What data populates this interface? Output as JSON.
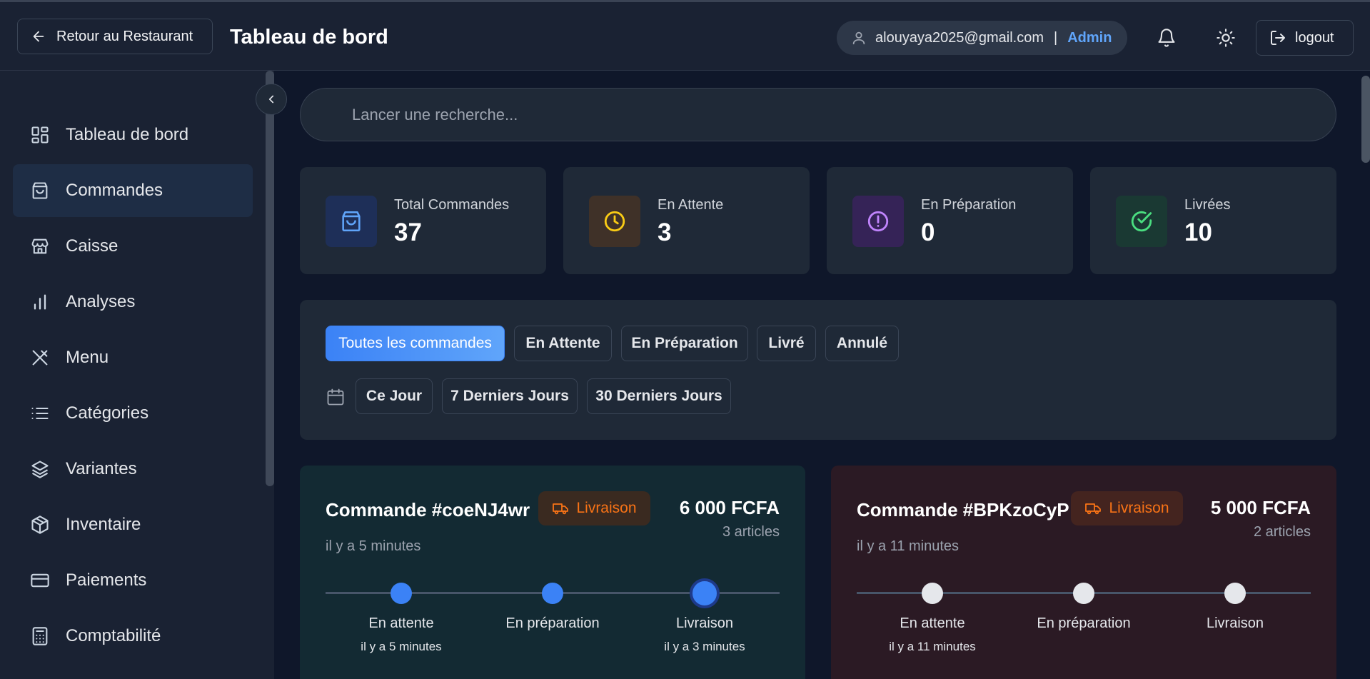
{
  "header": {
    "back_label": "Retour au Restaurant",
    "title": "Tableau de bord",
    "user_email": "alouyaya2025@gmail.com",
    "separator": "|",
    "user_role": "Admin",
    "logout_label": "logout"
  },
  "sidebar": {
    "items": [
      {
        "label": "Tableau de bord",
        "icon": "dashboard-icon"
      },
      {
        "label": "Commandes",
        "icon": "shopping-bag-icon",
        "active": true
      },
      {
        "label": "Caisse",
        "icon": "store-icon"
      },
      {
        "label": "Analyses",
        "icon": "bar-chart-icon"
      },
      {
        "label": "Menu",
        "icon": "utensils-icon"
      },
      {
        "label": "Catégories",
        "icon": "list-icon"
      },
      {
        "label": "Variantes",
        "icon": "layers-icon"
      },
      {
        "label": "Inventaire",
        "icon": "package-icon"
      },
      {
        "label": "Paiements",
        "icon": "credit-card-icon"
      },
      {
        "label": "Comptabilité",
        "icon": "calculator-icon"
      }
    ]
  },
  "search": {
    "placeholder": "Lancer une recherche..."
  },
  "stats": [
    {
      "label": "Total Commandes",
      "value": "37",
      "color": "#60a5fa"
    },
    {
      "label": "En Attente",
      "value": "3",
      "color": "#facc15"
    },
    {
      "label": "En Préparation",
      "value": "0",
      "color": "#c084fc"
    },
    {
      "label": "Livrées",
      "value": "10",
      "color": "#4ade80"
    }
  ],
  "filters": {
    "status": [
      "Toutes les commandes",
      "En Attente",
      "En Préparation",
      "Livré",
      "Annulé"
    ],
    "active_status": "Toutes les commandes",
    "periods": [
      "Ce Jour",
      "7 Derniers Jours",
      "30 Derniers Jours"
    ]
  },
  "orders": [
    {
      "title": "Commande #coeNJ4wr",
      "badge": "Livraison",
      "amount": "6 000 FCFA",
      "articles": "3 articles",
      "time": "il y a 5 minutes",
      "steps": [
        {
          "label": "En attente",
          "time": "il y a 5 minutes",
          "state": "done"
        },
        {
          "label": "En préparation",
          "time": "",
          "state": "done"
        },
        {
          "label": "Livraison",
          "time": "il y a 3 minutes",
          "state": "current"
        }
      ]
    },
    {
      "title": "Commande #BPKzoCyP",
      "badge": "Livraison",
      "amount": "5 000 FCFA",
      "articles": "2 articles",
      "time": "il y a 11 minutes",
      "steps": [
        {
          "label": "En attente",
          "time": "il y a 11 minutes",
          "state": "pending"
        },
        {
          "label": "En préparation",
          "time": "",
          "state": "pending"
        },
        {
          "label": "Livraison",
          "time": "",
          "state": "pending"
        }
      ]
    }
  ],
  "colors": {
    "accent": "#3b82f6",
    "admin_role": "#60a5fa",
    "badge_orange": "#f97316",
    "order1_bg": "#132a33",
    "order2_bg": "#2b1a24"
  }
}
